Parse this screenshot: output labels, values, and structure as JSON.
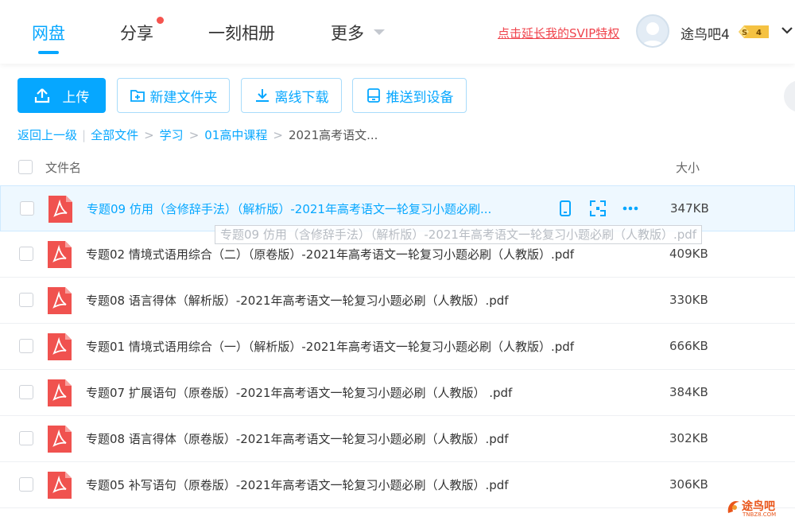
{
  "nav": {
    "tabs": [
      {
        "label": "网盘",
        "active": true
      },
      {
        "label": "分享",
        "has_badge_dot": true
      },
      {
        "label": "一刻相册"
      },
      {
        "label": "更多",
        "has_dropdown": true
      }
    ]
  },
  "header": {
    "svip_link": "点击延长我的SVIP特权",
    "username": "途鸟吧4",
    "vip_badge": {
      "symbol": "S",
      "level": "4"
    }
  },
  "toolbar": {
    "upload": "上传",
    "new_folder": "新建文件夹",
    "offline_download": "离线下载",
    "push_to_device": "推送到设备"
  },
  "breadcrumb": {
    "back": "返回上一级",
    "items": [
      "全部文件",
      "学习",
      "01高中课程"
    ],
    "current": "2021高考语文..."
  },
  "table": {
    "col_name": "文件名",
    "col_size": "大小",
    "rows": [
      {
        "name": "专题09 仿用（含修辞手法）（解析版）-2021年高考语文一轮复习小题必刷...",
        "size": "347KB",
        "active": true
      },
      {
        "name": "专题02 情境式语用综合（二）（原卷版）-2021年高考语文一轮复习小题必刷（人教版）.pdf",
        "size": "409KB"
      },
      {
        "name": "专题08 语言得体（解析版）-2021年高考语文一轮复习小题必刷（人教版）.pdf",
        "size": "330KB"
      },
      {
        "name": "专题01 情境式语用综合（一）（解析版）-2021年高考语文一轮复习小题必刷（人教版）.pdf",
        "size": "666KB"
      },
      {
        "name": "专题07 扩展语句（原卷版）-2021年高考语文一轮复习小题必刷（人教版） .pdf",
        "size": "384KB"
      },
      {
        "name": "专题08 语言得体（原卷版）-2021年高考语文一轮复习小题必刷（人教版）.pdf",
        "size": "302KB"
      },
      {
        "name": "专题05 补写语句（原卷版）-2021年高考语文一轮复习小题必刷（人教版）.pdf",
        "size": "306KB"
      }
    ]
  },
  "tooltip": "专题09 仿用（含修辞手法）（解析版）-2021年高考语文一轮复习小题必刷（人教版）.pdf",
  "watermark": {
    "text": "途鸟吧",
    "url": "TNBZ8.COM"
  },
  "colors": {
    "accent": "#06a7ff",
    "svip_red": "#f0444d",
    "pdf_red": "#f0524f",
    "badge_gold": "#f5c242"
  },
  "icons": [
    "upload-icon",
    "new-folder-icon",
    "download-icon",
    "device-icon",
    "pdf-file-icon",
    "phone-icon",
    "qr-share-icon",
    "more-icon",
    "chevron-down-icon"
  ]
}
